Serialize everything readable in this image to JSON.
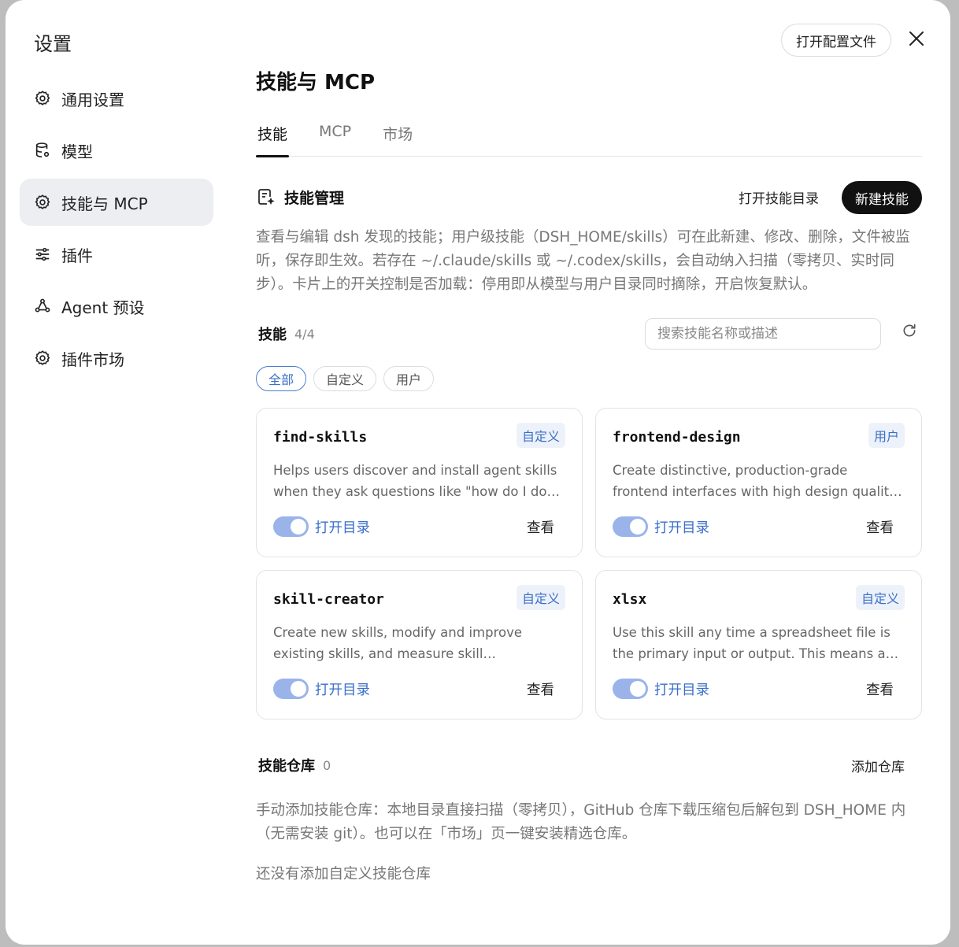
{
  "sidebar": {
    "title": "设置",
    "items": [
      {
        "label": "通用设置",
        "icon": "gear-icon"
      },
      {
        "label": "模型",
        "icon": "database-icon"
      },
      {
        "label": "技能与 MCP",
        "icon": "gear-icon",
        "active": true
      },
      {
        "label": "插件",
        "icon": "sliders-icon"
      },
      {
        "label": "Agent 预设",
        "icon": "agent-icon"
      },
      {
        "label": "插件市场",
        "icon": "gear-icon"
      }
    ]
  },
  "header": {
    "open_config_label": "打开配置文件",
    "page_title": "技能与 MCP"
  },
  "tabs": [
    {
      "label": "技能",
      "active": true
    },
    {
      "label": "MCP"
    },
    {
      "label": "市场"
    }
  ],
  "skill_mgmt": {
    "title": "技能管理",
    "open_dir_label": "打开技能目录",
    "new_label": "新建技能",
    "description": "查看与编辑 dsh 发现的技能；用户级技能（DSH_HOME/skills）可在此新建、修改、删除，文件被监听，保存即生效。若存在 ~/.claude/skills 或 ~/.codex/skills，会自动纳入扫描（零拷贝、实时同步）。卡片上的开关控制是否加载：停用即从模型与用户目录同时摘除，开启恢复默认。"
  },
  "skills": {
    "title": "技能",
    "count": "4/4",
    "search_placeholder": "搜索技能名称或描述",
    "filters": [
      {
        "label": "全部",
        "active": true
      },
      {
        "label": "自定义"
      },
      {
        "label": "用户"
      }
    ],
    "cards": [
      {
        "name": "find-skills",
        "badge": "自定义",
        "desc": "Helps users discover and install agent skills when they ask questions like \"how do I do X\"...",
        "enabled": true,
        "open_label": "打开目录",
        "view_label": "查看"
      },
      {
        "name": "frontend-design",
        "badge": "用户",
        "desc": "Create distinctive, production-grade frontend interfaces with high design quality. Use this...",
        "enabled": true,
        "open_label": "打开目录",
        "view_label": "查看"
      },
      {
        "name": "skill-creator",
        "badge": "自定义",
        "desc": "Create new skills, modify and improve existing skills, and measure skill performance. Use...",
        "enabled": true,
        "open_label": "打开目录",
        "view_label": "查看"
      },
      {
        "name": "xlsx",
        "badge": "自定义",
        "desc": "Use this skill any time a spreadsheet file is the primary input or output. This means any task...",
        "enabled": true,
        "open_label": "打开目录",
        "view_label": "查看"
      }
    ]
  },
  "repos": {
    "title": "技能仓库",
    "count": "0",
    "add_label": "添加仓库",
    "description": "手动添加技能仓库：本地目录直接扫描（零拷贝），GitHub 仓库下载压缩包后解包到 DSH_HOME 内（无需安装 git）。也可以在「市场」页一键安装精选仓库。",
    "empty_text": "还没有添加自定义技能仓库"
  },
  "colors": {
    "accent": "#3a6fc8",
    "toggle_on": "#9ab4ea",
    "primary_button": "#111111"
  }
}
